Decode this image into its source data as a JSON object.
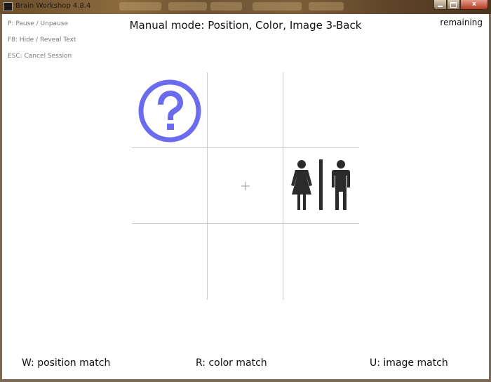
{
  "window": {
    "title": "Brain Workshop 4.8.4",
    "close_glyph": "x"
  },
  "hotkeys": [
    {
      "label": "P: Pause / Unpause"
    },
    {
      "label": "F8: Hide / Reveal Text"
    },
    {
      "label": "ESC: Cancel Session"
    }
  ],
  "session": {
    "mode_title": "Manual mode: Position, Color, Image 3-Back",
    "remaining_label": "remaining"
  },
  "stimuli": {
    "question_icon": "question-circle-icon",
    "question_color": "#6b6bf0",
    "restroom_icon": "restroom-icon",
    "restroom_color": "#2b2b2b"
  },
  "match_keys": [
    {
      "label": "W: position match"
    },
    {
      "label": "R: color match"
    },
    {
      "label": "U: image match"
    }
  ]
}
